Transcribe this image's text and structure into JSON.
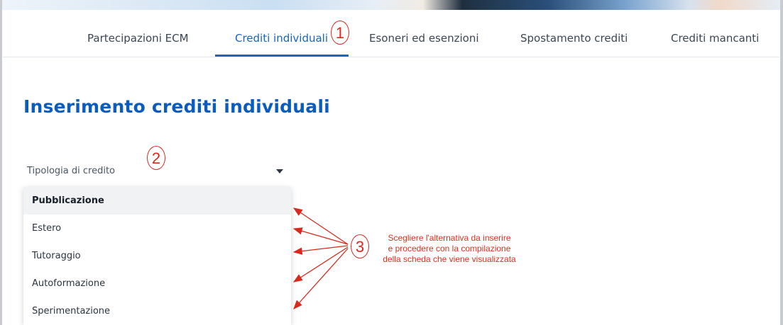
{
  "nav": {
    "tabs": [
      {
        "label": "Partecipazioni ECM"
      },
      {
        "label": "Crediti individuali"
      },
      {
        "label": "Esoneri ed esenzioni"
      },
      {
        "label": "Spostamento crediti"
      },
      {
        "label": "Crediti mancanti"
      }
    ]
  },
  "page": {
    "title": "Inserimento crediti individuali"
  },
  "select": {
    "label": "Tipologia di credito",
    "options": [
      {
        "label": "Pubblicazione"
      },
      {
        "label": "Estero"
      },
      {
        "label": "Tutoraggio"
      },
      {
        "label": "Autoformazione"
      },
      {
        "label": "Sperimentazione"
      }
    ]
  },
  "annotations": {
    "one": "1",
    "two": "2",
    "three": "3",
    "note_lines": [
      "Scegliere l'alternativa da inserire",
      "e procedere con la compilazione",
      "della scheda che viene visualizzata"
    ]
  },
  "colors": {
    "accent": "#0b5cbf",
    "annotation": "#d9291c"
  }
}
